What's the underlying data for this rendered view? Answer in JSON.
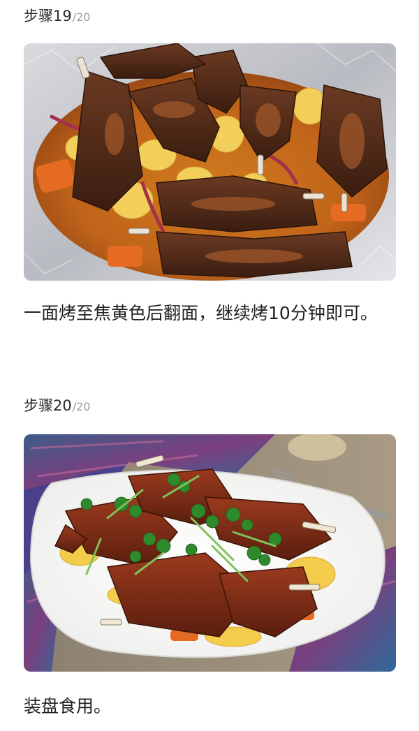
{
  "steps": [
    {
      "label": "步骤",
      "number": "19",
      "total": "/20",
      "image": "roasted-lamb-ribs-in-foil",
      "description": "一面烤至焦黄色后翻面，继续烤10分钟即可。"
    },
    {
      "label": "步骤",
      "number": "20",
      "total": "/20",
      "image": "plated-lamb-ribs-with-cilantro",
      "description": "装盘食用。"
    }
  ]
}
